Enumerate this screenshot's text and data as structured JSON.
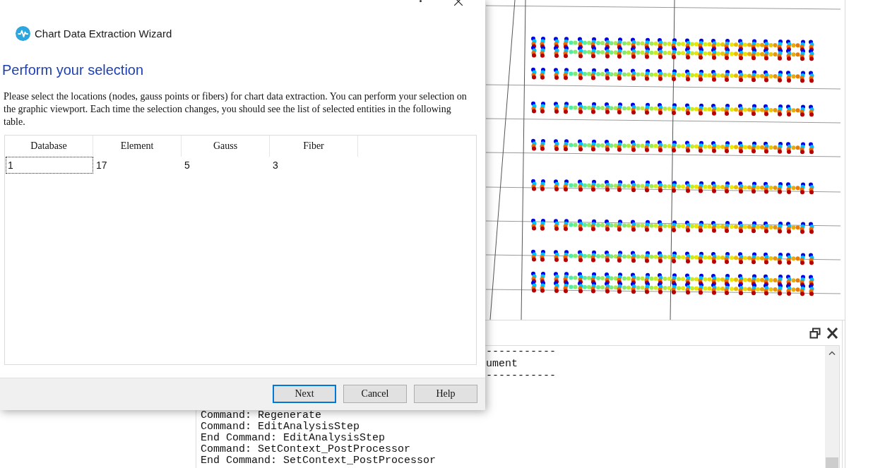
{
  "dialog": {
    "title": "Chart Data Extraction Wizard",
    "heading": "Perform your selection",
    "instructions": "Please select the locations (nodes, gauss points or fibers) for chart data extraction. You can perform your selection on the graphic viewport. Each time the selection changes, you should see the list of selected entities in the following table.",
    "table": {
      "columns": [
        "Database",
        "Element",
        "Gauss",
        "Fiber"
      ],
      "rows": [
        {
          "cells": [
            {
              "text": "1",
              "focused": true
            },
            {
              "text": "17",
              "focused": false
            },
            {
              "text": "5",
              "focused": false
            },
            {
              "text": "3",
              "focused": false
            }
          ]
        }
      ]
    },
    "buttons": [
      {
        "label": "Next",
        "default": true
      },
      {
        "label": "Cancel",
        "default": false
      },
      {
        "label": "Help",
        "default": false
      }
    ]
  },
  "console": {
    "partial_lines": [
      "-----------",
      "ument",
      "-----------"
    ],
    "lines": [
      "Command: Regenerate",
      "Command: EditAnalysisStep",
      "End Command: EditAnalysisStep",
      "Command: SetContext_PostProcessor",
      "End Command: SetContext_PostProcessor"
    ]
  }
}
